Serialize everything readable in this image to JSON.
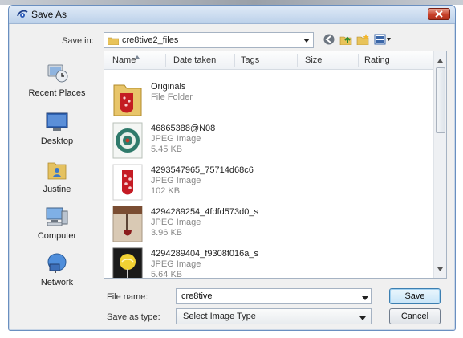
{
  "window": {
    "title": "Save As",
    "icon": "photoshop-eye-icon"
  },
  "toolbar": {
    "save_in_label": "Save in:",
    "location": "cre8tive2_files",
    "icons": [
      "back-icon",
      "up-folder-icon",
      "new-folder-icon",
      "views-menu-icon"
    ]
  },
  "places": [
    {
      "label": "Recent Places",
      "icon": "recent-places-icon"
    },
    {
      "label": "Desktop",
      "icon": "desktop-icon"
    },
    {
      "label": "Justine",
      "icon": "user-folder-icon"
    },
    {
      "label": "Computer",
      "icon": "computer-icon"
    },
    {
      "label": "Network",
      "icon": "network-icon"
    }
  ],
  "columns": [
    "Name",
    "Date taken",
    "Tags",
    "Size",
    "Rating"
  ],
  "files": [
    {
      "name": "Originals",
      "type": "File Folder",
      "size": ""
    },
    {
      "name": "46865388@N08",
      "type": "JPEG Image",
      "size": "5.45 KB"
    },
    {
      "name": "4293547965_75714d68c6",
      "type": "JPEG Image",
      "size": "102 KB"
    },
    {
      "name": "4294289254_4fdfd573d0_s",
      "type": "JPEG Image",
      "size": "3.96 KB"
    },
    {
      "name": "4294289404_f9308f016a_s",
      "type": "JPEG Image",
      "size": "5.64 KB"
    }
  ],
  "form": {
    "file_name_label": "File name:",
    "file_name_value": "cre8tive",
    "save_as_type_label": "Save as type:",
    "save_as_type_value": "Select Image Type"
  },
  "buttons": {
    "save": "Save",
    "cancel": "Cancel"
  }
}
